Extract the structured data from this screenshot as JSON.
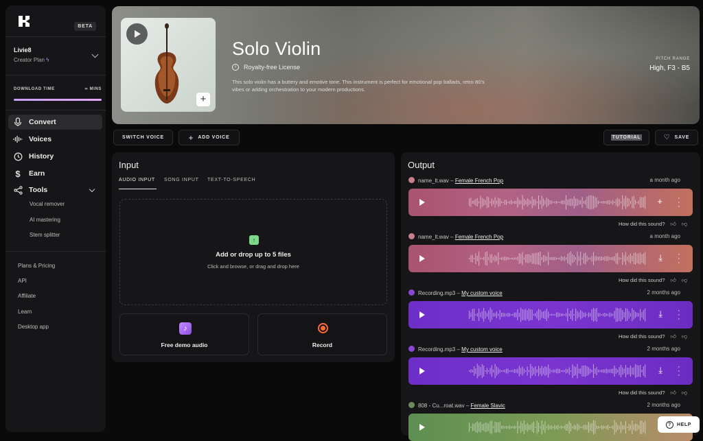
{
  "sidebar": {
    "beta_badge": "BETA",
    "user": {
      "name": "Livie8",
      "plan": "Creator Plan"
    },
    "download": {
      "label": "DOWNLOAD TIME",
      "value": "∞ MINS",
      "fill_fraction": 1.0
    },
    "nav": [
      {
        "label": "Convert",
        "icon": "microphone-icon",
        "active": true
      },
      {
        "label": "Voices",
        "icon": "waveform-icon"
      },
      {
        "label": "History",
        "icon": "history-icon"
      },
      {
        "label": "Earn",
        "icon": "dollar-icon"
      },
      {
        "label": "Tools",
        "icon": "share-icon"
      }
    ],
    "tools": [
      "Vocal remover",
      "AI mastering",
      "Stem splitter"
    ],
    "footer": [
      "Plans & Pricing",
      "API",
      "Affiliate",
      "Learn",
      "Desktop app"
    ]
  },
  "hero": {
    "title": "Solo Violin",
    "license": "Royalty-free License",
    "description": "This solo violin has a buttery and emotive tone. This instrument is perfect for emotional pop ballads, retro 80's vibes or adding orchestration to your modern productions.",
    "pitch_label": "PITCH RANGE",
    "pitch_value": "High, F3 - B5"
  },
  "toolbar": {
    "switch_voice": "SWITCH VOICE",
    "add_voice": "ADD VOICE",
    "tutorial": "TUTORIAL",
    "save": "SAVE"
  },
  "input": {
    "title": "Input",
    "tabs": [
      "AUDIO INPUT",
      "SONG INPUT",
      "TEXT-TO-SPEECH"
    ],
    "drop_title": "Add or drop up to 5 files",
    "drop_hint": "Click and browse, or drag and drop here",
    "demo_label": "Free demo audio",
    "record_label": "Record"
  },
  "output": {
    "title": "Output",
    "feedback": "How did this sound?",
    "items": [
      {
        "file": "name_lt.wav",
        "voice": "Female French Pop",
        "time": "a month ago",
        "action": "+",
        "color": "#c77f8c"
      },
      {
        "file": "name_lt.wav",
        "voice": "Female French Pop",
        "time": "a month ago",
        "action": "⤓",
        "color": "#c77f8c"
      },
      {
        "file": "Recording.mp3",
        "voice": "My custom voice",
        "time": "2 months ago",
        "action": "⤓",
        "color": "#8a47d6"
      },
      {
        "file": "Recording.mp3",
        "voice": "My custom voice",
        "time": "2 months ago",
        "action": "⤓",
        "color": "#8a47d6"
      },
      {
        "file": "808 - Cu...roat.wav",
        "voice": "Female Slavic",
        "time": "2 months ago",
        "action": "",
        "color": "#6b8b5a"
      }
    ]
  },
  "help_label": "HELP"
}
